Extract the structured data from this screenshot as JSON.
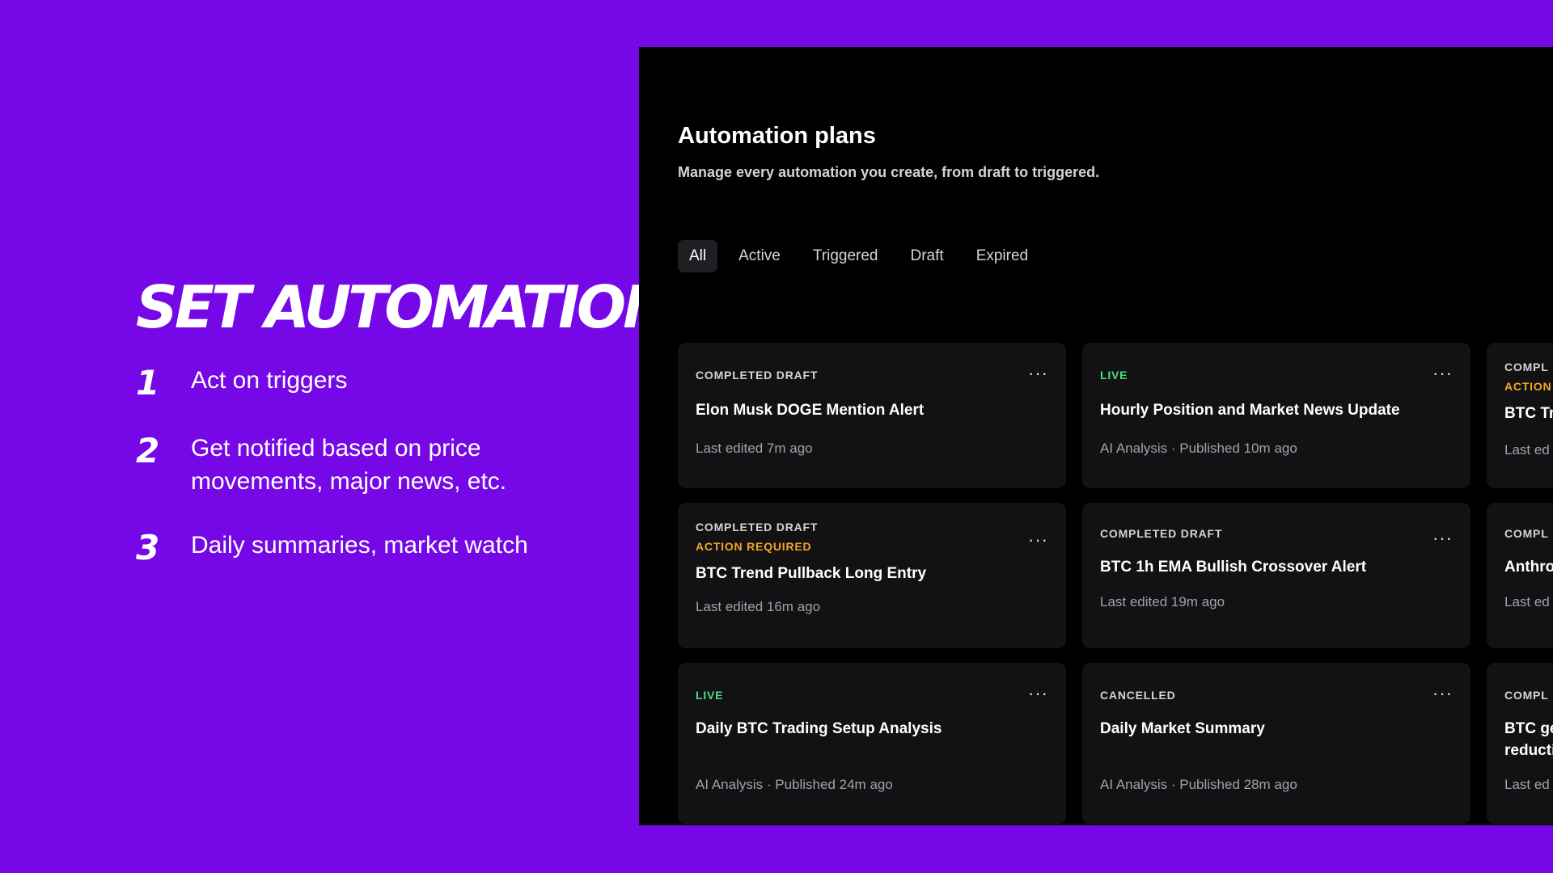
{
  "promo": {
    "title": "SET AUTOMATIONS",
    "items": [
      {
        "num": "1",
        "text": "Act on triggers"
      },
      {
        "num": "2",
        "text": "Get notified based on price movements, major news, etc."
      },
      {
        "num": "3",
        "text": "Daily summaries, market watch"
      }
    ]
  },
  "panel": {
    "title": "Automation plans",
    "subtitle": "Manage every automation you create, from draft to triggered.",
    "tabs": [
      "All",
      "Active",
      "Triggered",
      "Draft",
      "Expired"
    ],
    "active_tab": "All"
  },
  "cards": [
    {
      "status": "COMPLETED DRAFT",
      "title": "Elon Musk DOGE Mention Alert",
      "meta": "Last edited 7m ago"
    },
    {
      "status": "LIVE",
      "title": "Hourly Position and Market News Update",
      "meta": "AI Analysis · Published 10m ago"
    },
    {
      "status": "COMPL",
      "badge": "ACTION",
      "title": "BTC Tr",
      "meta": "Last ed"
    },
    {
      "status": "COMPLETED DRAFT",
      "badge": "ACTION REQUIRED",
      "title": "BTC Trend Pullback Long Entry",
      "meta": "Last edited 16m ago"
    },
    {
      "status": "COMPLETED DRAFT",
      "title": "BTC 1h EMA Bullish Crossover Alert",
      "meta": "Last edited 19m ago"
    },
    {
      "status": "COMPL",
      "title": "Anthro",
      "meta": "Last ed"
    },
    {
      "status": "LIVE",
      "title": "Daily BTC Trading Setup Analysis",
      "meta": "AI Analysis · Published 24m ago"
    },
    {
      "status": "CANCELLED",
      "title": "Daily Market Summary",
      "meta": "AI Analysis · Published 28m ago"
    },
    {
      "status": "COMPL",
      "title": "BTC ge",
      "title2": "reducti",
      "meta": "Last ed"
    }
  ],
  "menu_glyph": "···",
  "colors": {
    "background": "#7608e8",
    "panel": "#000000",
    "card": "#121214",
    "live": "#4ade80",
    "action": "#f5a524"
  }
}
